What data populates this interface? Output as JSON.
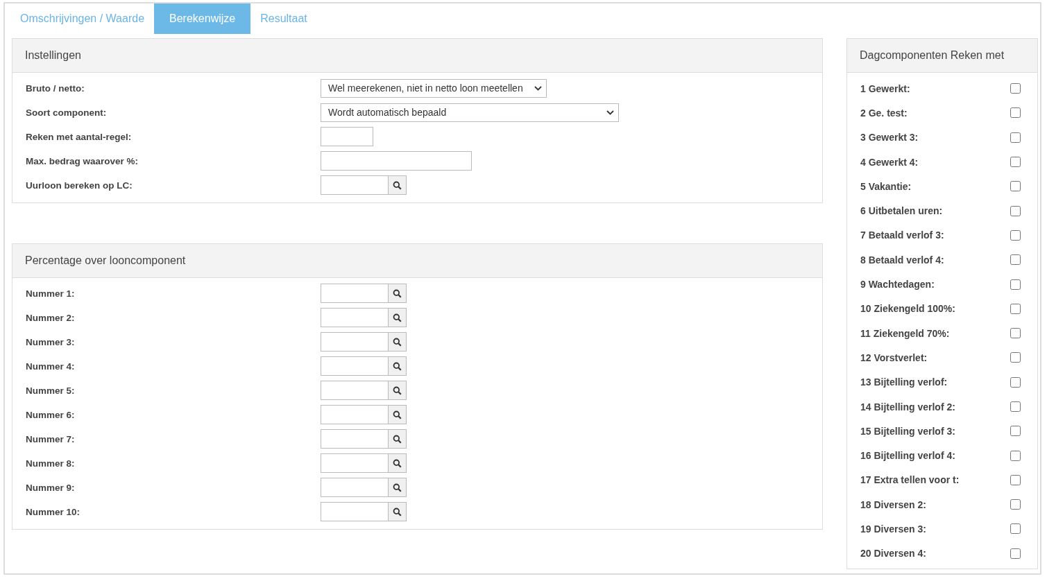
{
  "tabs": [
    {
      "label": "Omschrijvingen / Waarde",
      "selected": false
    },
    {
      "label": "Berekenwijze",
      "selected": true
    },
    {
      "label": "Resultaat",
      "selected": false
    }
  ],
  "panels": [
    {
      "title": "Instellingen",
      "fields": [
        {
          "label": "Bruto / netto:",
          "kind": "select",
          "value": "Wel meerekenen, niet in netto loon meetellen"
        },
        {
          "label": "Soort component:",
          "kind": "wide-select",
          "value": "Wordt automatisch bepaald"
        },
        {
          "label": "Reken met aantal-regel:",
          "kind": "short-text"
        },
        {
          "label": "Max. bedrag waarover %:",
          "kind": "text"
        },
        {
          "label": "Uurloon bereken op LC:",
          "kind": "lookup"
        }
      ]
    },
    {
      "title": "Percentage over looncomponent",
      "fields": [
        {
          "label": "Nummer 1:",
          "kind": "lookup"
        },
        {
          "label": "Nummer 2:",
          "kind": "lookup"
        },
        {
          "label": "Nummer 3:",
          "kind": "lookup"
        },
        {
          "label": "Nummer 4:",
          "kind": "lookup"
        },
        {
          "label": "Nummer 5:",
          "kind": "lookup"
        },
        {
          "label": "Nummer 6:",
          "kind": "lookup"
        },
        {
          "label": "Nummer 7:",
          "kind": "lookup"
        },
        {
          "label": "Nummer 8:",
          "kind": "lookup"
        },
        {
          "label": "Nummer 9:",
          "kind": "lookup"
        },
        {
          "label": "Nummer 10:",
          "kind": "lookup"
        }
      ]
    }
  ],
  "day_components": {
    "title": "Dagcomponenten Reken met",
    "items": [
      {
        "label": "1 Gewerkt:",
        "checked": false
      },
      {
        "label": "2 Ge. test:",
        "checked": false
      },
      {
        "label": "3 Gewerkt 3:",
        "checked": false
      },
      {
        "label": "4 Gewerkt 4:",
        "checked": false
      },
      {
        "label": "5 Vakantie:",
        "checked": false
      },
      {
        "label": "6 Uitbetalen uren:",
        "checked": false
      },
      {
        "label": "7 Betaald verlof 3:",
        "checked": false
      },
      {
        "label": "8 Betaald verlof 4:",
        "checked": false
      },
      {
        "label": "9 Wachtedagen:",
        "checked": false
      },
      {
        "label": "10 Ziekengeld 100%:",
        "checked": false
      },
      {
        "label": "11 Ziekengeld 70%:",
        "checked": false
      },
      {
        "label": "12 Vorstverlet:",
        "checked": false
      },
      {
        "label": "13 Bijtelling verlof:",
        "checked": false
      },
      {
        "label": "14 Bijtelling verlof 2:",
        "checked": false
      },
      {
        "label": "15 Bijtelling verlof 3:",
        "checked": false
      },
      {
        "label": "16 Bijtelling verlof 4:",
        "checked": false
      },
      {
        "label": "17 Extra tellen voor t:",
        "checked": false
      },
      {
        "label": "18 Diversen 2:",
        "checked": false
      },
      {
        "label": "19 Diversen 3:",
        "checked": false
      },
      {
        "label": "20 Diversen 4:",
        "checked": false
      }
    ]
  }
}
